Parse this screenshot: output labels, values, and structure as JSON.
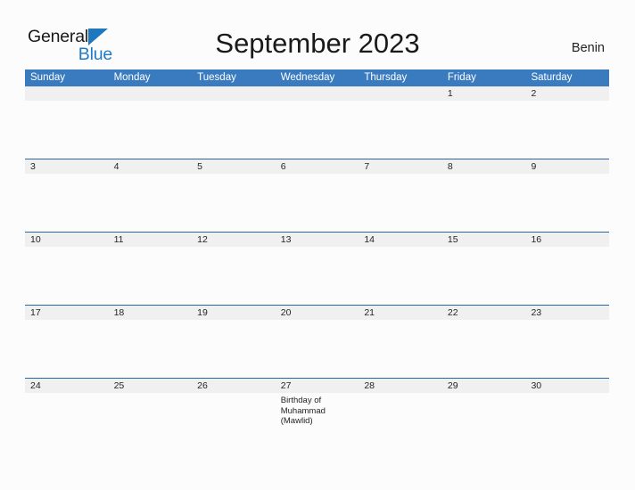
{
  "brand": {
    "name_part1": "General",
    "name_part2": "Blue",
    "triangle_icon": "triangle-icon",
    "accent_color": "#1f7bc4"
  },
  "header": {
    "title": "September 2023",
    "country": "Benin"
  },
  "colors": {
    "header_blue": "#3a7bbf",
    "row_divider_blue": "#2a679e",
    "daynum_strip": "#f0f0f0",
    "page_background": "#fcfcfd",
    "text": "#242424"
  },
  "calendar": {
    "month": "September",
    "year": "2023",
    "weekdays": [
      "Sunday",
      "Monday",
      "Tuesday",
      "Wednesday",
      "Thursday",
      "Friday",
      "Saturday"
    ],
    "weeks": [
      {
        "days": [
          {
            "num": "",
            "event": ""
          },
          {
            "num": "",
            "event": ""
          },
          {
            "num": "",
            "event": ""
          },
          {
            "num": "",
            "event": ""
          },
          {
            "num": "",
            "event": ""
          },
          {
            "num": "1",
            "event": ""
          },
          {
            "num": "2",
            "event": ""
          }
        ]
      },
      {
        "days": [
          {
            "num": "3",
            "event": ""
          },
          {
            "num": "4",
            "event": ""
          },
          {
            "num": "5",
            "event": ""
          },
          {
            "num": "6",
            "event": ""
          },
          {
            "num": "7",
            "event": ""
          },
          {
            "num": "8",
            "event": ""
          },
          {
            "num": "9",
            "event": ""
          }
        ]
      },
      {
        "days": [
          {
            "num": "10",
            "event": ""
          },
          {
            "num": "11",
            "event": ""
          },
          {
            "num": "12",
            "event": ""
          },
          {
            "num": "13",
            "event": ""
          },
          {
            "num": "14",
            "event": ""
          },
          {
            "num": "15",
            "event": ""
          },
          {
            "num": "16",
            "event": ""
          }
        ]
      },
      {
        "days": [
          {
            "num": "17",
            "event": ""
          },
          {
            "num": "18",
            "event": ""
          },
          {
            "num": "19",
            "event": ""
          },
          {
            "num": "20",
            "event": ""
          },
          {
            "num": "21",
            "event": ""
          },
          {
            "num": "22",
            "event": ""
          },
          {
            "num": "23",
            "event": ""
          }
        ]
      },
      {
        "days": [
          {
            "num": "24",
            "event": ""
          },
          {
            "num": "25",
            "event": ""
          },
          {
            "num": "26",
            "event": ""
          },
          {
            "num": "27",
            "event": "Birthday of Muhammad (Mawlid)"
          },
          {
            "num": "28",
            "event": ""
          },
          {
            "num": "29",
            "event": ""
          },
          {
            "num": "30",
            "event": ""
          }
        ]
      }
    ]
  }
}
